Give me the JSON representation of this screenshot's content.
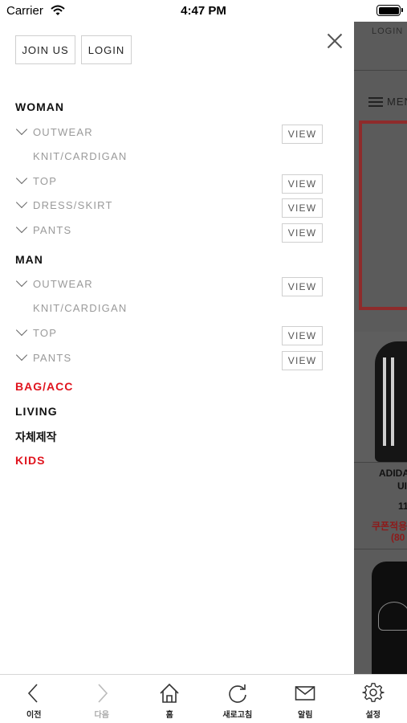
{
  "status_bar": {
    "carrier": "Carrier",
    "time": "4:47 PM"
  },
  "background_page": {
    "login": "LOGIN",
    "menu": "MEN",
    "product1_name_line1": "ADIDA",
    "product1_name_line2": "UI",
    "product1_price": "11",
    "product1_coupon_line1": "쿠폰적용",
    "product1_coupon_line2": "(80"
  },
  "drawer": {
    "join_label": "JOIN US",
    "login_label": "LOGIN",
    "view_label": "VIEW",
    "woman": {
      "title": "WOMAN",
      "items": [
        "OUTWEAR",
        "KNIT/CARDIGAN",
        "TOP",
        "DRESS/SKIRT",
        "PANTS"
      ]
    },
    "man": {
      "title": "MAN",
      "items": [
        "OUTWEAR",
        "KNIT/CARDIGAN",
        "TOP",
        "PANTS"
      ]
    },
    "bag_acc": "BAG/ACC",
    "living": "LIVING",
    "own_made": "자체제작",
    "kids": "KIDS",
    "colors": {
      "accent_red": "#e0141e",
      "sub_gray": "#9a9a9a"
    }
  },
  "tabbar": {
    "items": [
      {
        "label": "이전",
        "icon": "chevron-left-icon"
      },
      {
        "label": "다음",
        "icon": "chevron-right-icon"
      },
      {
        "label": "홈",
        "icon": "home-icon"
      },
      {
        "label": "새로고침",
        "icon": "refresh-icon"
      },
      {
        "label": "알림",
        "icon": "mail-icon"
      },
      {
        "label": "설정",
        "icon": "gear-icon"
      }
    ]
  }
}
